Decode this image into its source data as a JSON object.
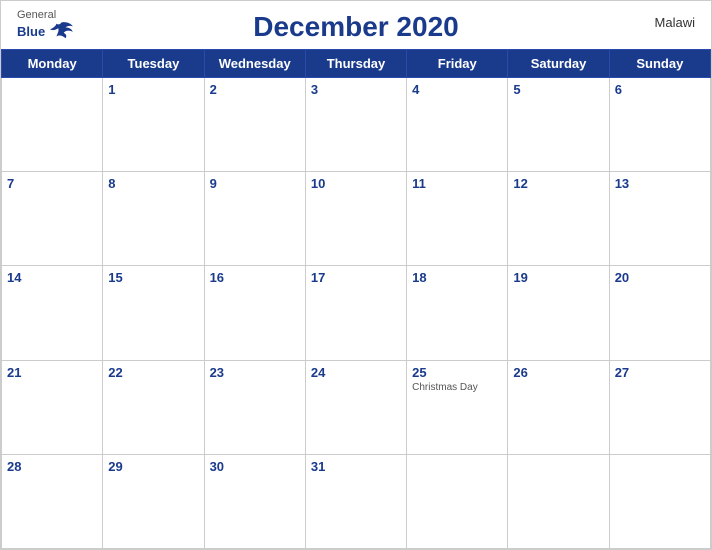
{
  "header": {
    "logo": {
      "general": "General",
      "blue": "Blue"
    },
    "title": "December 2020",
    "country": "Malawi"
  },
  "weekdays": [
    "Monday",
    "Tuesday",
    "Wednesday",
    "Thursday",
    "Friday",
    "Saturday",
    "Sunday"
  ],
  "weeks": [
    [
      {
        "day": "",
        "empty": true
      },
      {
        "day": "1"
      },
      {
        "day": "2"
      },
      {
        "day": "3"
      },
      {
        "day": "4"
      },
      {
        "day": "5"
      },
      {
        "day": "6"
      }
    ],
    [
      {
        "day": "7"
      },
      {
        "day": "8"
      },
      {
        "day": "9"
      },
      {
        "day": "10"
      },
      {
        "day": "11"
      },
      {
        "day": "12"
      },
      {
        "day": "13"
      }
    ],
    [
      {
        "day": "14"
      },
      {
        "day": "15"
      },
      {
        "day": "16"
      },
      {
        "day": "17"
      },
      {
        "day": "18"
      },
      {
        "day": "19"
      },
      {
        "day": "20"
      }
    ],
    [
      {
        "day": "21"
      },
      {
        "day": "22"
      },
      {
        "day": "23"
      },
      {
        "day": "24"
      },
      {
        "day": "25",
        "holiday": "Christmas Day"
      },
      {
        "day": "26"
      },
      {
        "day": "27"
      }
    ],
    [
      {
        "day": "28"
      },
      {
        "day": "29"
      },
      {
        "day": "30"
      },
      {
        "day": "31"
      },
      {
        "day": "",
        "empty": true
      },
      {
        "day": "",
        "empty": true
      },
      {
        "day": "",
        "empty": true
      }
    ]
  ]
}
